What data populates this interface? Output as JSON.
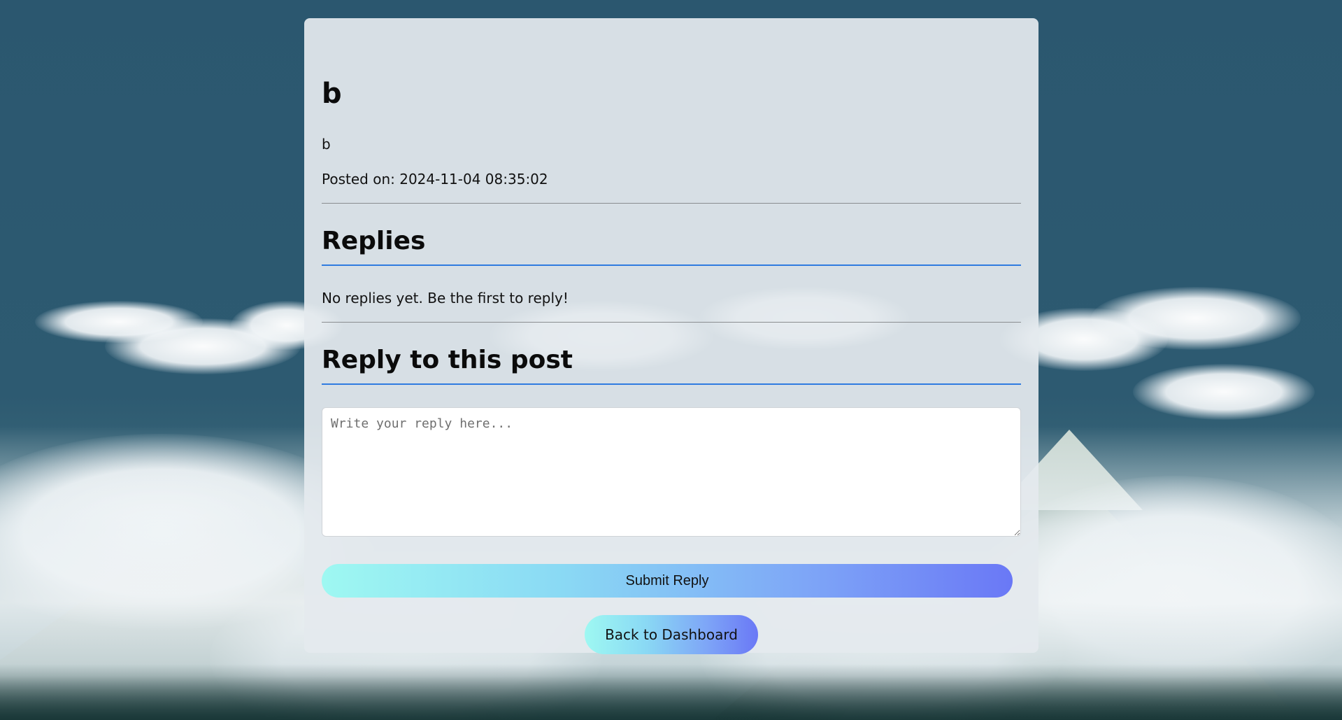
{
  "post": {
    "title": "b",
    "body": "b",
    "posted_label": "Posted on:",
    "posted_at": "2024-11-04 08:35:02"
  },
  "replies": {
    "heading": "Replies",
    "empty_message": "No replies yet. Be the first to reply!"
  },
  "reply_form": {
    "heading": "Reply to this post",
    "placeholder": "Write your reply here...",
    "submit_label": "Submit Reply"
  },
  "navigation": {
    "back_label": "Back to Dashboard"
  },
  "colors": {
    "accent": "#2f7be0",
    "button_gradient_start": "#9ef8f2",
    "button_gradient_end": "#6a78f6",
    "card_background": "#e4e9ee",
    "page_background": "#2d5a71"
  }
}
